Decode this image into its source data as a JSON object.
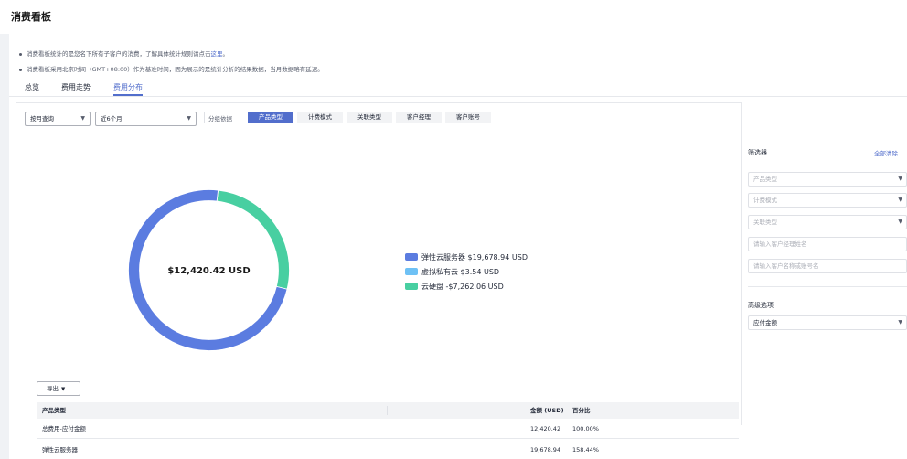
{
  "page": {
    "title": "消费看板"
  },
  "notes": [
    {
      "text": "消费看板统计的是您名下所有子客户的消费，了解具体统计规则请点击",
      "link": "这里",
      "after": "。"
    },
    {
      "text": "消费看板采用北京时间（GMT+08:00）作为基准时间，因为展示的是统计分析的结果数据，当月数据略有延迟。"
    }
  ],
  "tabs": [
    {
      "label": "总览"
    },
    {
      "label": "费用走势"
    },
    {
      "label": "费用分布",
      "active": true
    }
  ],
  "toolbar": {
    "period_type": "按月查询",
    "period_range": "近6个月",
    "group_label": "分组依据",
    "groups": [
      {
        "label": "产品类型",
        "active": true
      },
      {
        "label": "计费模式"
      },
      {
        "label": "关联类型"
      },
      {
        "label": "客户经理"
      },
      {
        "label": "客户账号"
      }
    ]
  },
  "chart_data": {
    "type": "pie",
    "style": "donut",
    "center_label": "$12,420.42 USD",
    "categories": [
      "弹性云服务器",
      "虚拟私有云",
      "云硬盘"
    ],
    "values": [
      19678.94,
      3.54,
      -7262.06
    ],
    "colors": [
      "#5b7ce0",
      "#6ec1f5",
      "#48cfa1"
    ],
    "legend": [
      "弹性云服务器 $19,678.94 USD",
      "虚拟私有云 $3.54 USD",
      "云硬盘 -$7,262.06 USD"
    ],
    "legend_position": "right"
  },
  "export": {
    "label": "导出"
  },
  "table": {
    "headers": [
      "产品类型",
      "金额 (USD)",
      "百分比"
    ],
    "rows": [
      [
        "总费用-应付金额",
        "12,420.42",
        "100.00%"
      ],
      [
        "弹性云服务器",
        "19,678.94",
        "158.44%"
      ]
    ]
  },
  "filter": {
    "title": "筛选器",
    "clear_all": "全部清除",
    "selects": [
      "产品类型",
      "计费模式",
      "关联类型"
    ],
    "inputs": [
      "请输入客户经理姓名",
      "请输入客户名称或账号名"
    ],
    "advanced_title": "高级选项",
    "advanced_select": "应付金额"
  },
  "colors": {
    "accent": "#526ecc",
    "donut_main": "#5b7ce0",
    "donut_vpc": "#6ec1f5",
    "donut_disk": "#48cfa1"
  },
  "icons": {
    "dropdown": "chevron-down-icon"
  }
}
